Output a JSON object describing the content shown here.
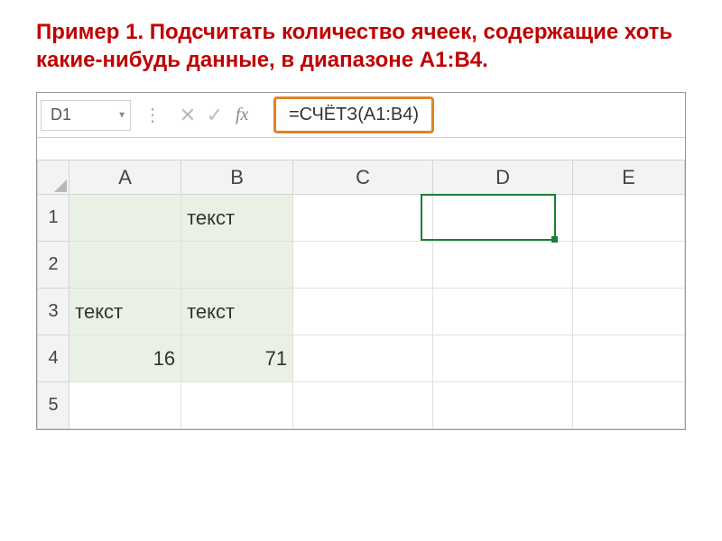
{
  "title": "Пример 1. Подсчитать количество ячеек, содержащие хоть какие-нибудь данные, в диапазоне A1:B4.",
  "formula_bar": {
    "name_box": "D1",
    "cancel_glyph": "✕",
    "enter_glyph": "✓",
    "fx_label": "fx",
    "formula": "=СЧЁТЗ(A1:B4)"
  },
  "columns": [
    "A",
    "B",
    "C",
    "D",
    "E"
  ],
  "rows": [
    "1",
    "2",
    "3",
    "4",
    "5"
  ],
  "cells": {
    "B1": "текст",
    "A3": "текст",
    "B3": "текст",
    "A4": "16",
    "B4": "71"
  },
  "active_cell": "D1"
}
